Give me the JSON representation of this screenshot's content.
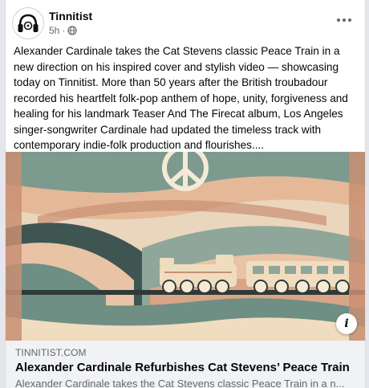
{
  "post": {
    "page_name": "Tinnitist",
    "time": "5h",
    "separator": "·",
    "privacy_icon": "globe-icon",
    "more_icon": "more-options-icon",
    "body": "Alexander Cardinale takes the Cat Stevens classic Peace Train in a new direction on his inspired cover and stylish video — showcasing today on Tinnitist. More than 50 years after the British troubadour recorded his heartfelt folk-pop anthem of hope, unity, forgiveness and healing for his landmark Teaser And The Firecat album, Los Angeles singer-songwriter Cardinale had updated the timeless track with contemporary indie-folk production and flourishes...."
  },
  "link_preview": {
    "domain": "TINNITIST.COM",
    "title": "Alexander Cardinale Refurbishes Cat Stevens’ Peace Train",
    "description": "Alexander Cardinale takes the Cat Stevens classic Peace Train in a n...",
    "info_label": "i",
    "image_subject": "retro illustration of a peace symbol and a train on rolling hills"
  },
  "colors": {
    "text_primary": "#050505",
    "text_secondary": "#65676b",
    "link_bg": "#f0f2f5",
    "art_teal": "#6f8e84",
    "art_peach": "#e8c3a6",
    "art_cream": "#f0ddc0",
    "art_dark": "#2f3a38"
  }
}
